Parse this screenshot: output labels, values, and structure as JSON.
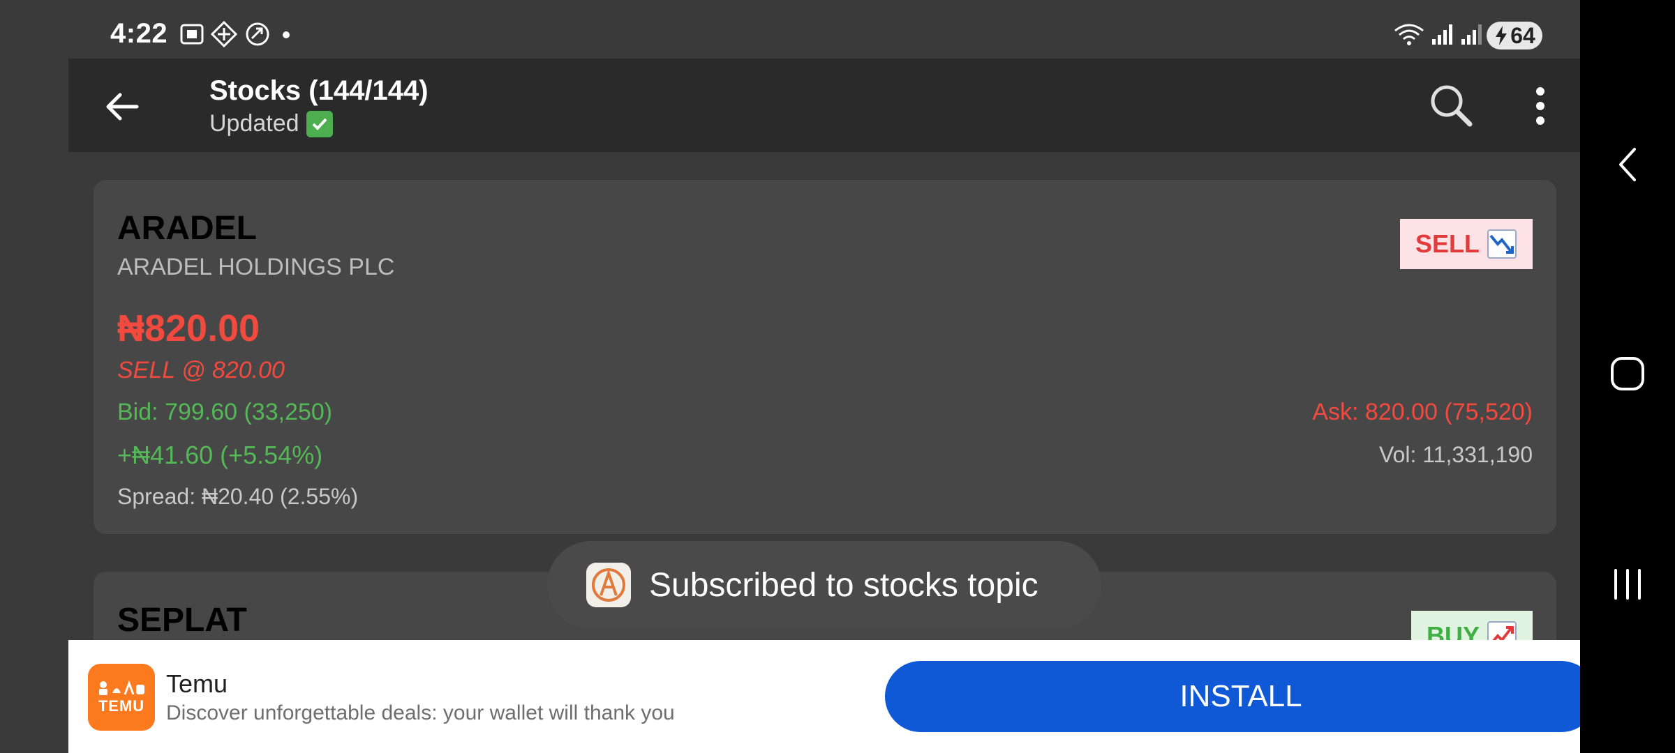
{
  "status_bar": {
    "time": "4:22",
    "battery": "64"
  },
  "app_bar": {
    "title": "Stocks (144/144)",
    "subtitle": "Updated"
  },
  "stocks": [
    {
      "symbol": "ARADEL",
      "company": "ARADEL HOLDINGS PLC",
      "price": "₦820.00",
      "signal": "SELL @ 820.00",
      "bid": "Bid: 799.60 (33,250)",
      "ask": "Ask: 820.00 (75,520)",
      "change": "+₦41.60 (+5.54%)",
      "volume": "Vol: 11,331,190",
      "spread": "Spread: ₦20.40 (2.55%)",
      "badge": "SELL"
    },
    {
      "symbol": "SEPLAT",
      "badge": "BUY"
    }
  ],
  "toast": {
    "text": "Subscribed to stocks topic"
  },
  "ad": {
    "logo_text": "TEMU",
    "name": "Temu",
    "description": "Discover unforgettable deals: your wallet will thank you",
    "install_label": "INSTALL"
  },
  "colors": {
    "sell": "#f24a3f",
    "buy": "#55b857",
    "install": "#0f58d6",
    "temu": "#fb7a1d"
  }
}
